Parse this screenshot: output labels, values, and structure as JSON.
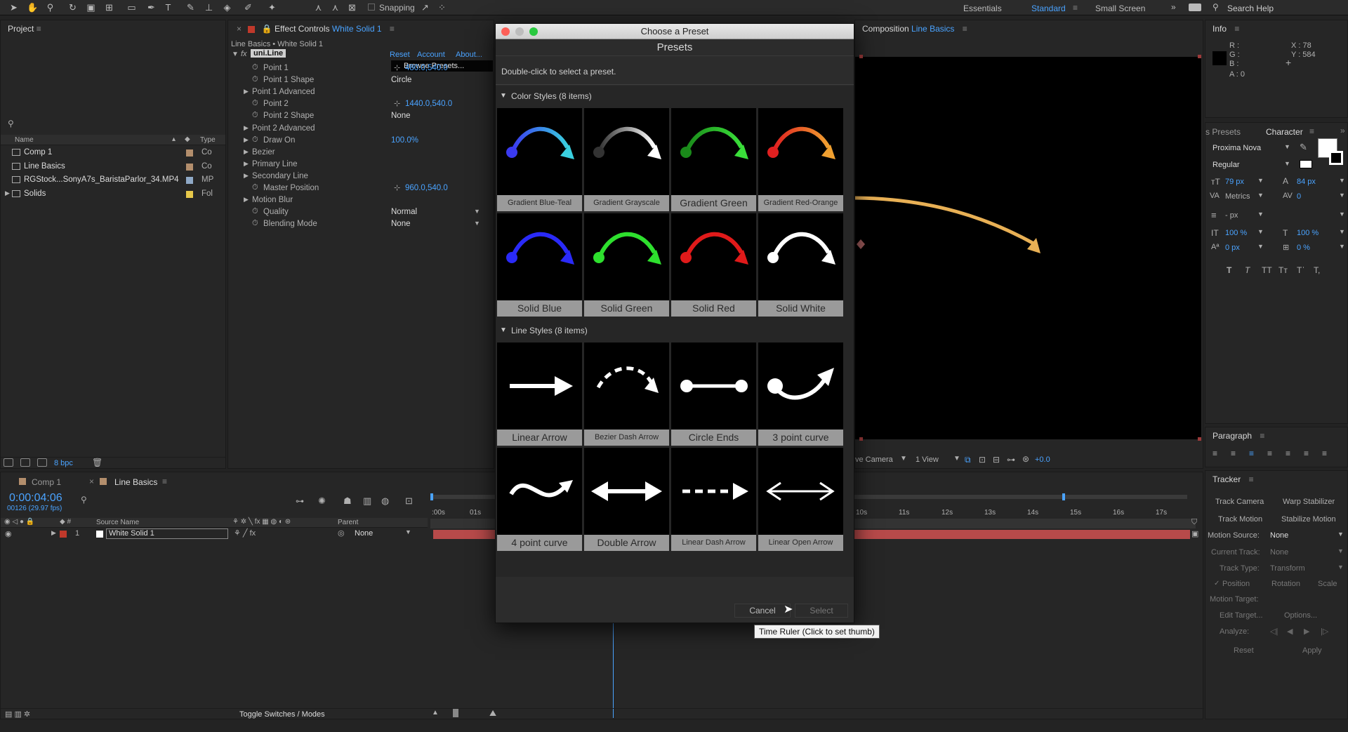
{
  "toolbar": {
    "snapping": "Snapping",
    "workspaces": [
      "Essentials",
      "Standard",
      "Small Screen"
    ],
    "search": "Search Help"
  },
  "project": {
    "title": "Project",
    "columns": {
      "name": "Name",
      "type": "Type"
    },
    "items": [
      {
        "name": "Comp 1",
        "type": "Co",
        "color": "#b38e6c"
      },
      {
        "name": "Line Basics",
        "type": "Co",
        "color": "#b38e6c"
      },
      {
        "name": "RGStock...SonyA7s_BaristaParlor_34.MP4",
        "type": "MP",
        "color": "#8fa9c7"
      },
      {
        "name": "Solids",
        "type": "Fol",
        "color": "#e6c84a"
      }
    ],
    "bpc": "8 bpc"
  },
  "effects": {
    "title": "Effect Controls",
    "layer": "White Solid 1",
    "breadcrumb": "Line Basics • White Solid 1",
    "fx": "uni.Line",
    "reset": "Reset",
    "account": "Account",
    "about": "About...",
    "browse": "Browse Presets...",
    "props": [
      {
        "name": "Point 1",
        "value": "480.0,540.0",
        "indent": 2,
        "blue": true
      },
      {
        "name": "Point 1 Shape",
        "value": "Circle",
        "indent": 2
      },
      {
        "name": "Point 1 Advanced",
        "value": "",
        "indent": 1
      },
      {
        "name": "Point 2",
        "value": "1440.0,540.0",
        "indent": 2,
        "blue": true
      },
      {
        "name": "Point 2 Shape",
        "value": "None",
        "indent": 2
      },
      {
        "name": "Point 2 Advanced",
        "value": "",
        "indent": 1
      },
      {
        "name": "Draw On",
        "value": "100.0%",
        "indent": 1,
        "blue": true
      },
      {
        "name": "Bezier",
        "value": "",
        "indent": 1
      },
      {
        "name": "Primary Line",
        "value": "",
        "indent": 1
      },
      {
        "name": "Secondary Line",
        "value": "",
        "indent": 1
      },
      {
        "name": "Master Position",
        "value": "960.0,540.0",
        "indent": 2,
        "blue": true
      },
      {
        "name": "Motion Blur",
        "value": "",
        "indent": 1
      },
      {
        "name": "Quality",
        "value": "Normal",
        "indent": 2
      },
      {
        "name": "Blending Mode",
        "value": "None",
        "indent": 2
      }
    ]
  },
  "composition": {
    "title": "Composition",
    "name": "Line Basics",
    "camera": "ve Camera",
    "view": "1 View",
    "offset": "+0.0"
  },
  "info": {
    "title": "Info",
    "r": "R :",
    "g": "G :",
    "b": "B :",
    "a": "A : 0",
    "x": "X : 78",
    "y": "Y : 584"
  },
  "character": {
    "tab_presets": "s Presets",
    "title": "Character",
    "font": "Proxima Nova",
    "style": "Regular",
    "size": "79 px",
    "leading": "84 px",
    "kerning": "Metrics",
    "tracking": "0",
    "stroke": "- px",
    "vscale": "100 %",
    "hscale": "100 %",
    "baseline": "0 px",
    "tsume": "0 %"
  },
  "paragraph": {
    "title": "Paragraph"
  },
  "tracker": {
    "title": "Tracker",
    "track_camera": "Track Camera",
    "warp": "Warp Stabilizer",
    "track_motion": "Track Motion",
    "stabilize": "Stabilize Motion",
    "motion_source_label": "Motion Source:",
    "motion_source": "None",
    "current_track_label": "Current Track:",
    "current_track": "None",
    "track_type_label": "Track Type:",
    "track_type": "Transform",
    "position": "Position",
    "rotation": "Rotation",
    "scale": "Scale",
    "motion_target": "Motion Target:",
    "edit_target": "Edit Target...",
    "options": "Options...",
    "analyze": "Analyze:",
    "reset": "Reset",
    "apply": "Apply"
  },
  "timeline": {
    "tab1": "Comp 1",
    "tab2": "Line Basics",
    "timecode": "0:00:04:06",
    "frames": "00126 (29.97 fps)",
    "source_name": "Source Name",
    "parent": "Parent",
    "layer_num": "1",
    "layer_name": "White Solid 1",
    "layer_parent": "None",
    "toggle": "Toggle Switches / Modes",
    "ticks_left": [
      ":00s",
      "01s"
    ],
    "ticks_right": [
      "10s",
      "11s",
      "12s",
      "13s",
      "14s",
      "15s",
      "16s",
      "17s"
    ]
  },
  "dialog": {
    "title": "Choose a Preset",
    "heading": "Presets",
    "hint": "Double-click to select a preset.",
    "section1": "Color Styles (8 items)",
    "section2": "Line Styles (8 items)",
    "color_presets": [
      {
        "label": "Gradient Blue-Teal",
        "c1": "#3a3af0",
        "c2": "#3ad0e0",
        "small": true
      },
      {
        "label": "Gradient Grayscale",
        "c1": "#333333",
        "c2": "#ffffff",
        "small": true
      },
      {
        "label": "Gradient Green",
        "c1": "#1a8a1a",
        "c2": "#3adf3a",
        "small": false
      },
      {
        "label": "Gradient Red-Orange",
        "c1": "#e02020",
        "c2": "#f0a030",
        "small": true
      },
      {
        "label": "Solid Blue",
        "c1": "#2a2af8",
        "c2": "#2a2af8",
        "small": false
      },
      {
        "label": "Solid Green",
        "c1": "#2ee02e",
        "c2": "#2ee02e",
        "small": false
      },
      {
        "label": "Solid Red",
        "c1": "#e01a1a",
        "c2": "#e01a1a",
        "small": false
      },
      {
        "label": "Solid White",
        "c1": "#ffffff",
        "c2": "#ffffff",
        "small": false
      }
    ],
    "line_presets": [
      {
        "label": "Linear Arrow",
        "kind": "linear",
        "small": false
      },
      {
        "label": "Bezier Dash Arrow",
        "kind": "bezdash",
        "small": true
      },
      {
        "label": "Circle Ends",
        "kind": "circles",
        "small": false
      },
      {
        "label": "3 point curve",
        "kind": "three",
        "small": false
      },
      {
        "label": "4 point curve",
        "kind": "four",
        "small": false
      },
      {
        "label": "Double Arrow",
        "kind": "double",
        "small": false
      },
      {
        "label": "Linear Dash Arrow",
        "kind": "lindash",
        "small": true
      },
      {
        "label": "Linear Open Arrow",
        "kind": "open",
        "small": true
      }
    ],
    "cancel": "Cancel",
    "select": "Select"
  },
  "tooltip": "Time Ruler (Click to set thumb)"
}
